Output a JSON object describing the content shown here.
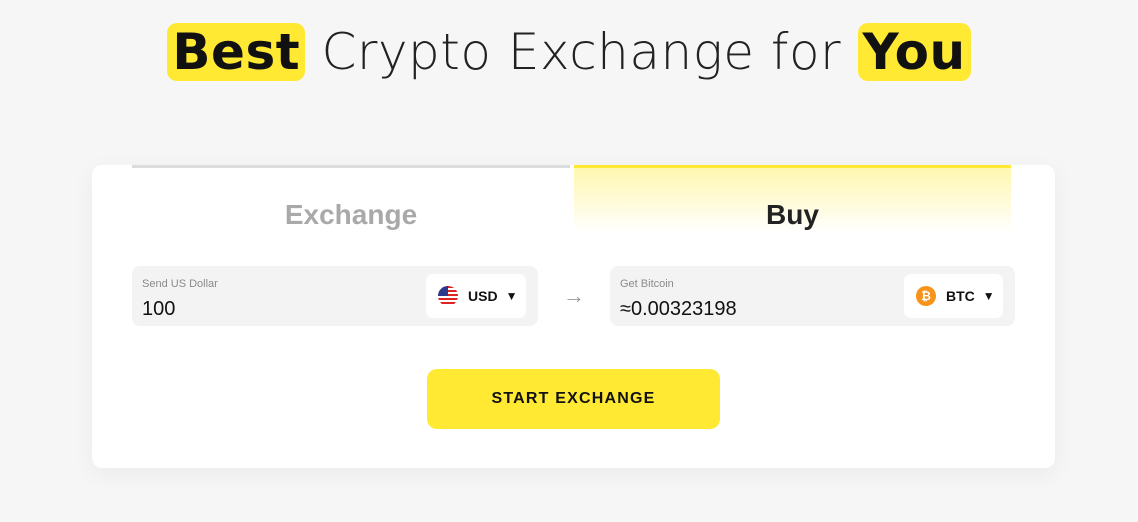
{
  "headline": {
    "highlight_1": "Best",
    "middle": " Crypto Exchange for ",
    "highlight_2": "You"
  },
  "tabs": {
    "exchange": "Exchange",
    "buy": "Buy",
    "active": "Buy"
  },
  "send": {
    "label": "Send US Dollar",
    "value": "100",
    "currency": "USD",
    "icon": "us-flag-icon"
  },
  "get": {
    "label": "Get Bitcoin",
    "value": "≈0.00323198",
    "currency": "BTC",
    "icon": "bitcoin-icon"
  },
  "arrow": "→",
  "caret": "▼",
  "btc_symbol": "₿",
  "start_button": "START EXCHANGE",
  "colors": {
    "accent": "#ffe933",
    "background": "#f6f6f6",
    "bitcoin": "#f7931a"
  }
}
